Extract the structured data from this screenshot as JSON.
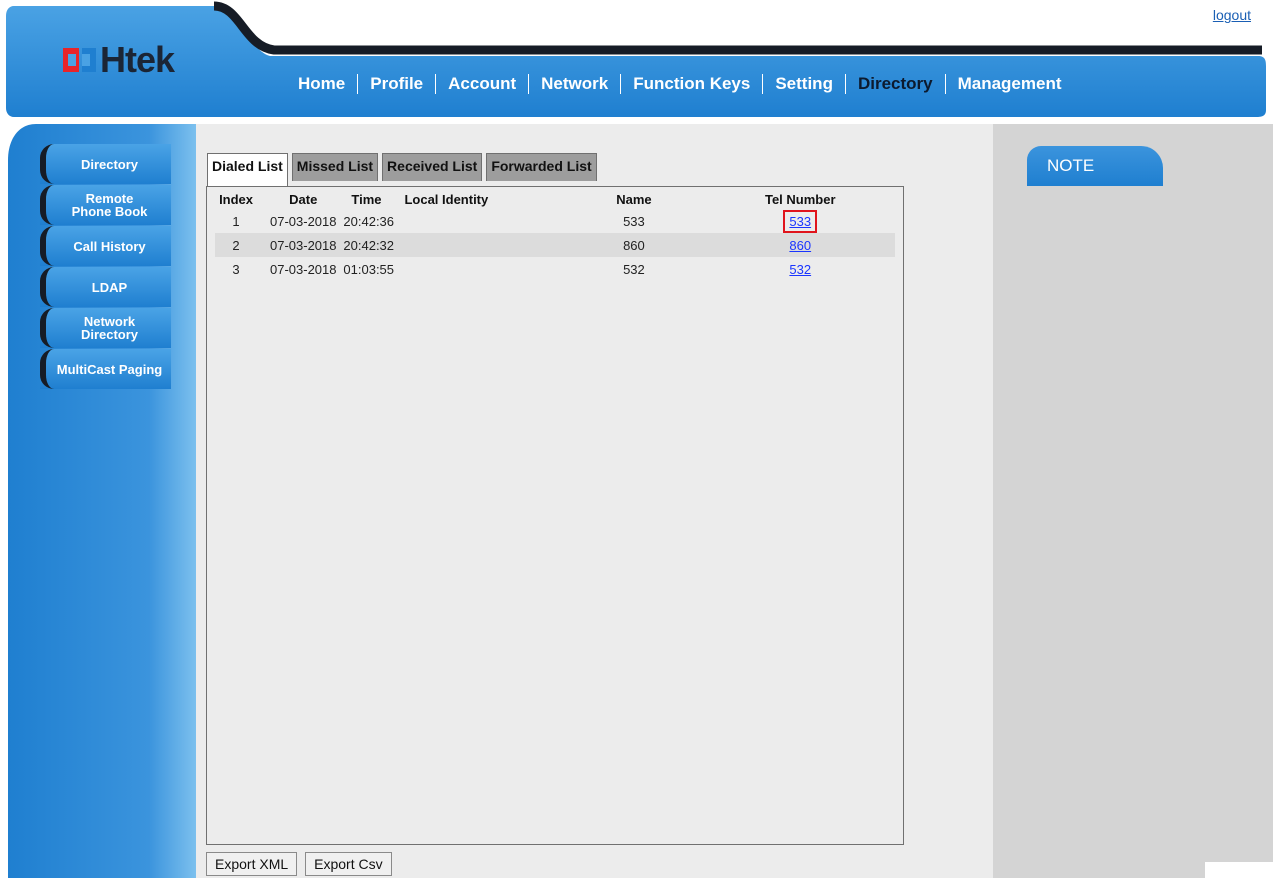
{
  "header": {
    "logout": "logout",
    "logo_text": "Htek",
    "nav": [
      {
        "label": "Home",
        "active": false
      },
      {
        "label": "Profile",
        "active": false
      },
      {
        "label": "Account",
        "active": false
      },
      {
        "label": "Network",
        "active": false
      },
      {
        "label": "Function Keys",
        "active": false
      },
      {
        "label": "Setting",
        "active": false
      },
      {
        "label": "Directory",
        "active": true
      },
      {
        "label": "Management",
        "active": false
      }
    ]
  },
  "sidebar": {
    "items": [
      {
        "label": "Directory"
      },
      {
        "label": "Remote Phone Book"
      },
      {
        "label": "Call History"
      },
      {
        "label": "LDAP"
      },
      {
        "label": "Network Directory"
      },
      {
        "label": "MultiCast Paging"
      }
    ]
  },
  "tabs": [
    {
      "label": "Dialed List",
      "active": true
    },
    {
      "label": "Missed List",
      "active": false
    },
    {
      "label": "Received List",
      "active": false
    },
    {
      "label": "Forwarded List",
      "active": false
    }
  ],
  "table": {
    "headers": [
      "Index",
      "Date",
      "Time",
      "Local Identity",
      "Name",
      "Tel Number"
    ],
    "rows": [
      {
        "index": "1",
        "date": "07-03-2018",
        "time": "20:42:36",
        "local_identity": "",
        "name": "533",
        "tel": "533"
      },
      {
        "index": "2",
        "date": "07-03-2018",
        "time": "20:42:32",
        "local_identity": "",
        "name": "860",
        "tel": "860"
      },
      {
        "index": "3",
        "date": "07-03-2018",
        "time": "01:03:55",
        "local_identity": "",
        "name": "532",
        "tel": "532"
      }
    ]
  },
  "buttons": {
    "export_xml": "Export XML",
    "export_csv": "Export Csv"
  },
  "note": {
    "title": "NOTE"
  },
  "colors": {
    "brand_blue": "#1f7fd0",
    "logo_red": "#e8242a",
    "logo_dark": "#1b2535",
    "highlight": "#e0141c"
  }
}
